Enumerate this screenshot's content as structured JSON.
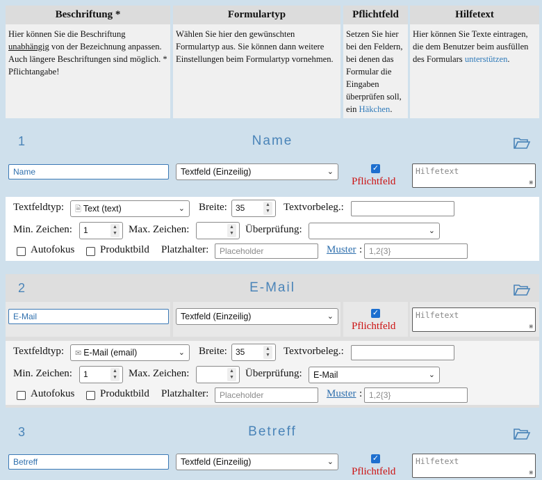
{
  "header": {
    "col1_title": "Beschriftung *",
    "col1_text_a": "Hier können Sie die Beschriftung ",
    "col1_text_u": "unabhängig",
    "col1_text_b": " von der Bezeichnung anpassen. Auch längere Beschriftungen sind möglich. * Pflichtangabe!",
    "col2_title": "Formulartyp",
    "col2_text": "Wählen Sie hier den gewünschten Formulartyp aus. Sie können dann weitere Einstellungen beim Formulartyp vornehmen.",
    "col3_title": "Pflichtfeld",
    "col3_text_a": "Setzen Sie hier bei den Feldern, bei denen das Formular die Eingaben überprüfen soll, ein ",
    "col3_link": "Häkchen",
    "col3_text_b": ".",
    "col4_title": "Hilfetext",
    "col4_text_a": "Hier können Sie Texte eintragen, die dem Benutzer beim ausfüllen des Formulars ",
    "col4_link": "unterstützen",
    "col4_text_b": "."
  },
  "labels": {
    "required": "Pflichtfeld",
    "help_placeholder": "Hilfetext",
    "textfeldtyp": "Textfeldtyp:",
    "breite": "Breite:",
    "textvorbeleg": "Textvorbeleg.:",
    "min_zeichen": "Min. Zeichen:",
    "max_zeichen": "Max. Zeichen:",
    "ueberpruefung": "Überprüfung:",
    "autofokus": "Autofokus",
    "produktbild": "Produktbild",
    "platzhalter": "Platzhalter:",
    "platzhalter_placeholder": "Placeholder",
    "muster": "Muster",
    "muster_colon": ":",
    "muster_placeholder": "1,2{3}"
  },
  "sections": [
    {
      "number": "1",
      "title": "Name",
      "label_value": "Name",
      "form_type": "Textfeld (Einzeilig)",
      "required": true,
      "field_type": "Text (text)",
      "field_type_icon": "document-icon",
      "width": "35",
      "min_chars": "1",
      "max_chars": "",
      "validation": ""
    },
    {
      "number": "2",
      "title": "E-Mail",
      "label_value": "E-Mail",
      "form_type": "Textfeld (Einzeilig)",
      "required": true,
      "field_type": "E-Mail (email)",
      "field_type_icon": "envelope-icon",
      "width": "35",
      "min_chars": "1",
      "max_chars": "",
      "validation": "E-Mail"
    },
    {
      "number": "3",
      "title": "Betreff",
      "label_value": "Betreff",
      "form_type": "Textfeld (Einzeilig)",
      "required": true
    }
  ],
  "icons": {
    "section_toggle": "folder-open-icon",
    "dropdown": "chevron-down-icon"
  }
}
